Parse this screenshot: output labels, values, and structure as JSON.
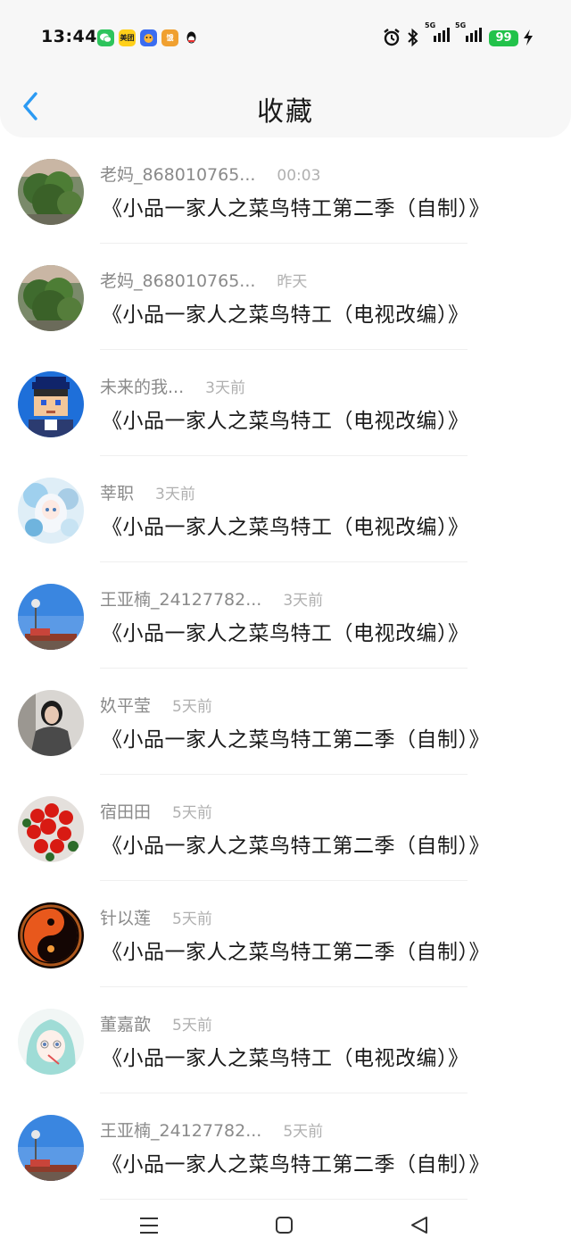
{
  "status_bar": {
    "time": "13:44",
    "notification_apps": [
      {
        "name": "wechat-icon",
        "color": "#2dc45c"
      },
      {
        "name": "meituan-icon",
        "label": "美团",
        "color": "#ffd01a"
      },
      {
        "name": "game-app-icon",
        "color": "#3a6cf0"
      },
      {
        "name": "food-app-icon",
        "label": "饿",
        "color": "#f0a030"
      },
      {
        "name": "qq-icon",
        "color": "#111111"
      }
    ],
    "network_1": "5G",
    "network_2": "5G",
    "battery": "99"
  },
  "header": {
    "title": "收藏",
    "back_icon": "chevron-left-icon",
    "accent": "#2b9af3"
  },
  "items": [
    {
      "name": "老妈_868010765...",
      "time": "00:03",
      "content": "《小品一家人之菜鸟特工第二季（自制）》",
      "avatar": "plant"
    },
    {
      "name": "老妈_868010765...",
      "time": "昨天",
      "content": "《小品一家人之菜鸟特工（电视改编）》",
      "avatar": "plant"
    },
    {
      "name": "未来的我...",
      "time": "3天前",
      "content": "《小品一家人之菜鸟特工（电视改编）》",
      "avatar": "pixel"
    },
    {
      "name": "莘职",
      "time": "3天前",
      "content": "《小品一家人之菜鸟特工（电视改编）》",
      "avatar": "anime"
    },
    {
      "name": "王亚楠_24127782...",
      "time": "3天前",
      "content": "《小品一家人之菜鸟特工（电视改编）》",
      "avatar": "sky"
    },
    {
      "name": "奺平莹",
      "time": "5天前",
      "content": "《小品一家人之菜鸟特工第二季（自制）》",
      "avatar": "person"
    },
    {
      "name": "宿田田",
      "time": "5天前",
      "content": "《小品一家人之菜鸟特工第二季（自制）》",
      "avatar": "flower"
    },
    {
      "name": "针以莲",
      "time": "5天前",
      "content": "《小品一家人之菜鸟特工第二季（自制）》",
      "avatar": "yinyang"
    },
    {
      "name": "董嘉歆",
      "time": "5天前",
      "content": "《小品一家人之菜鸟特工（电视改编）》",
      "avatar": "girl"
    },
    {
      "name": "王亚楠_24127782...",
      "time": "5天前",
      "content": "《小品一家人之菜鸟特工第二季（自制）》",
      "avatar": "sky"
    }
  ],
  "nav": {
    "menu_icon": "menu-icon",
    "home_icon": "home-square-icon",
    "back_icon": "back-triangle-icon"
  }
}
